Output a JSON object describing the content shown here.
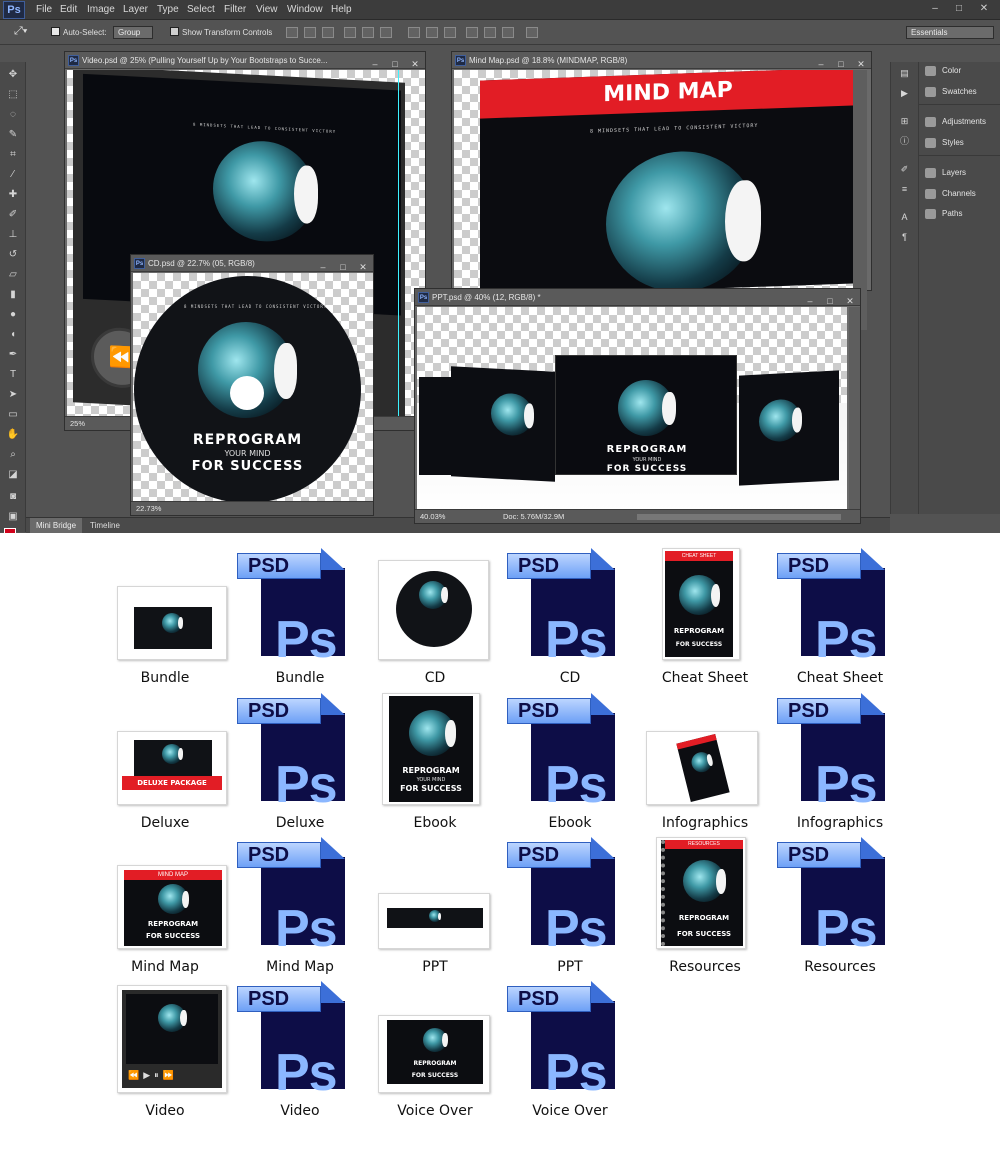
{
  "app": {
    "logo": "Ps",
    "menu": [
      "File",
      "Edit",
      "Image",
      "Layer",
      "Type",
      "Select",
      "Filter",
      "View",
      "Window",
      "Help"
    ],
    "window_controls": [
      "–",
      "□",
      "✕"
    ]
  },
  "options_bar": {
    "auto_select_label": "Auto-Select:",
    "auto_select_value": "Group",
    "transform_label": "Show Transform Controls",
    "workspace": "Essentials"
  },
  "panels": {
    "items": [
      "Color",
      "Swatches",
      "Adjustments",
      "Styles",
      "Layers",
      "Channels",
      "Paths"
    ]
  },
  "bottom_tabs": [
    "Mini Bridge",
    "Timeline"
  ],
  "documents": {
    "video": {
      "title": "Video.psd @ 25% (Pulling Yourself Up  by Your Bootstraps to Succe...",
      "zoom": "25%",
      "tagline": "8 MINDSETS THAT LEAD TO CONSISTENT VICTORY"
    },
    "mindmap": {
      "title": "Mind Map.psd @ 18.8% (MINDMAP, RGB/8)",
      "banner": "MIND MAP",
      "tagline": "8 MINDSETS THAT LEAD TO CONSISTENT VICTORY"
    },
    "cd": {
      "title": "CD.psd @ 22.7% (05, RGB/8)",
      "zoom": "22.73%",
      "tagline": "8 MINDSETS THAT LEAD TO CONSISTENT VICTORY",
      "line1": "REPROGRAM",
      "line2": "YOUR MIND",
      "line3": "FOR SUCCESS"
    },
    "ppt": {
      "title": "PPT.psd @ 40% (12, RGB/8) *",
      "zoom": "40.03%",
      "doc_size": "Doc: 5.76M/32.9M",
      "line1": "REPROGRAM",
      "line2": "YOUR MIND",
      "line3": "FOR SUCCESS"
    }
  },
  "psd_icon": {
    "tab": "PSD",
    "glyph": "Ps"
  },
  "files": [
    {
      "label": "Bundle",
      "kind": "image"
    },
    {
      "label": "Bundle",
      "kind": "psd"
    },
    {
      "label": "CD",
      "kind": "image"
    },
    {
      "label": "CD",
      "kind": "psd"
    },
    {
      "label": "Cheat Sheet",
      "kind": "image"
    },
    {
      "label": "Cheat Sheet",
      "kind": "psd"
    },
    {
      "label": "Deluxe",
      "kind": "image"
    },
    {
      "label": "Deluxe",
      "kind": "psd"
    },
    {
      "label": "Ebook",
      "kind": "image"
    },
    {
      "label": "Ebook",
      "kind": "psd"
    },
    {
      "label": "Infographics",
      "kind": "image"
    },
    {
      "label": "Infographics",
      "kind": "psd"
    },
    {
      "label": "Mind Map",
      "kind": "image"
    },
    {
      "label": "Mind Map",
      "kind": "psd"
    },
    {
      "label": "PPT",
      "kind": "image"
    },
    {
      "label": "PPT",
      "kind": "psd"
    },
    {
      "label": "Resources",
      "kind": "image"
    },
    {
      "label": "Resources",
      "kind": "psd"
    },
    {
      "label": "Video",
      "kind": "image"
    },
    {
      "label": "Video",
      "kind": "psd"
    },
    {
      "label": "Voice Over",
      "kind": "image"
    },
    {
      "label": "Voice Over",
      "kind": "psd"
    }
  ],
  "thumb_text": {
    "deluxe_ribbon": "DELUXE PACKAGE",
    "cheat_header": "CHEAT SHEET",
    "mindmap_header": "MIND MAP",
    "resources_header": "RESOURCES",
    "cover_line1": "REPROGRAM",
    "cover_line2": "YOUR MIND",
    "cover_line3": "FOR SUCCESS"
  },
  "colors": {
    "accent_red": "#e21d25",
    "ps_blue": "#0d0d47",
    "ps_light": "#8bb7ff"
  }
}
